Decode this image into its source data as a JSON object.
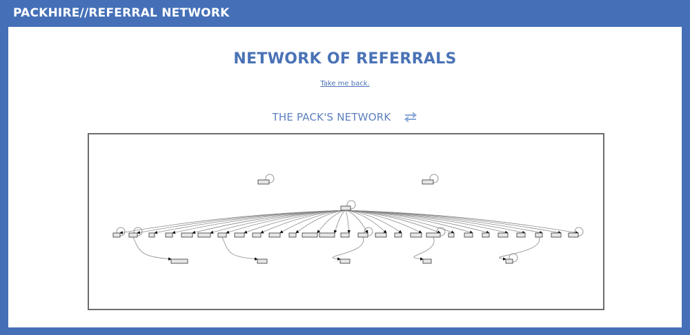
{
  "header": {
    "title": "PACKHIRE//REFERRAL NETWORK"
  },
  "main": {
    "page_title": "NETWORK OF REFERRALS",
    "back_link": "Take me back.",
    "section_title": "THE PACK'S NETWORK"
  },
  "icons": {
    "swap": "swap-arrows-icon"
  },
  "colors": {
    "frame": "#4570b8",
    "title": "#4a72b6",
    "node_fill": "#e6e6e6",
    "node_stroke": "#333333",
    "edge": "#888888"
  },
  "diagram": {
    "type": "directed-graph",
    "node_count": 36,
    "hub_referrals": 27,
    "second_level_referrals": 5,
    "isolated_self_referring_nodes": 2,
    "self_loops": 9
  }
}
